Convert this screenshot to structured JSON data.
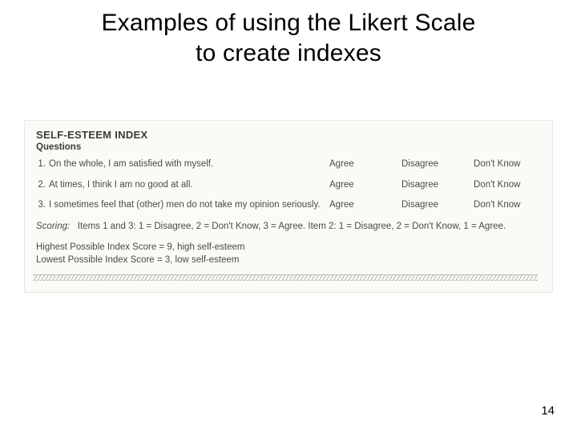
{
  "title_line1": "Examples of using the Likert Scale",
  "title_line2": "to create indexes",
  "scan": {
    "index_title": "SELF-ESTEEM INDEX",
    "questions_label": "Questions",
    "options": {
      "agree": "Agree",
      "disagree": "Disagree",
      "dontknow": "Don't Know"
    },
    "items": [
      {
        "num": "1.",
        "text": "On the whole, I am satisfied with myself."
      },
      {
        "num": "2.",
        "text": "At times, I think I am no good at all."
      },
      {
        "num": "3.",
        "text": "I sometimes feel that (other) men do not take my opinion seriously."
      }
    ],
    "scoring_label": "Scoring:",
    "scoring_text": "Items 1 and 3: 1 = Disagree, 2 = Don't Know, 3 = Agree. Item 2: 1 = Disagree, 2 = Don't Know, 1 = Agree.",
    "highest": "Highest Possible Index Score = 9, high self-esteem",
    "lowest": "Lowest Possible Index Score = 3, low self-esteem"
  },
  "page_number": "14"
}
